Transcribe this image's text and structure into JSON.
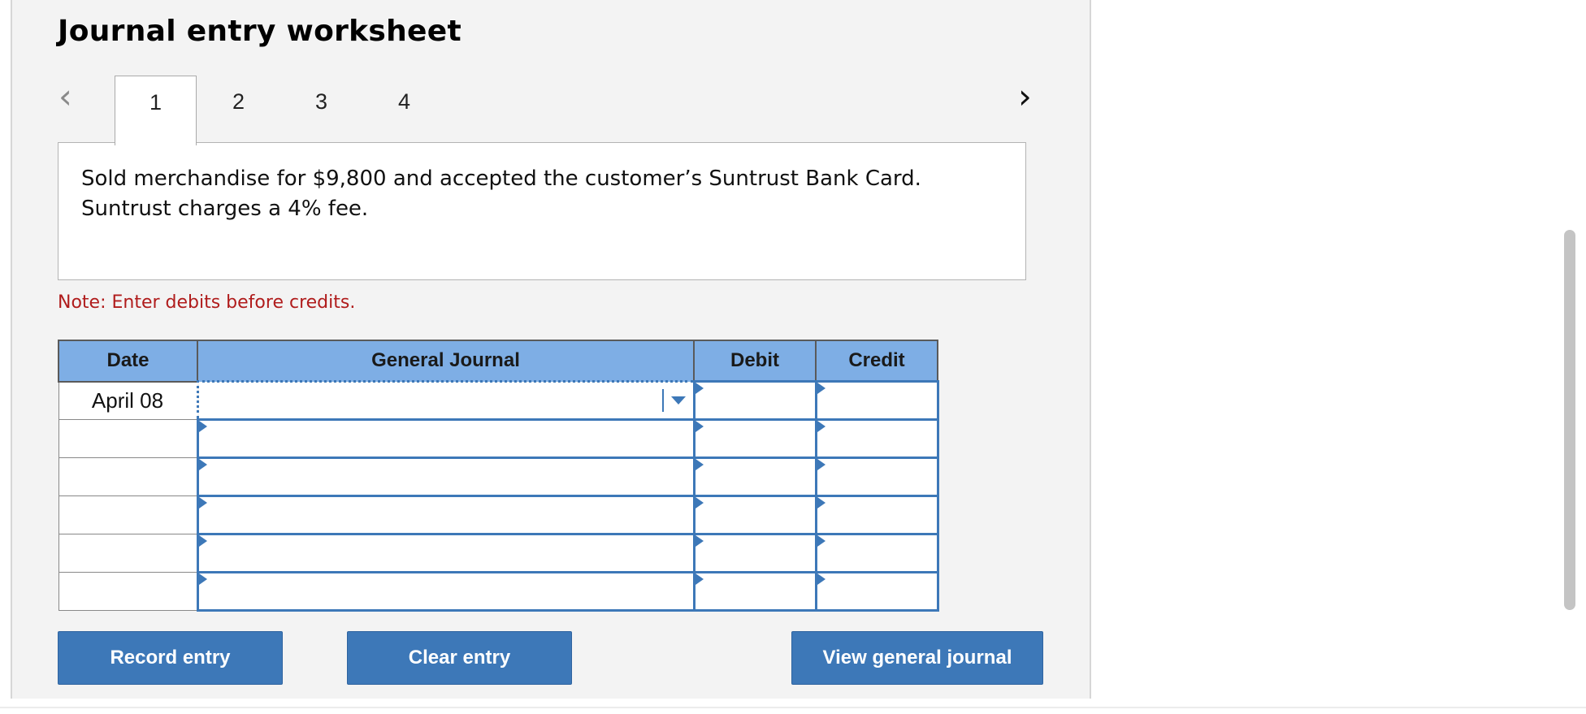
{
  "title": "Journal entry worksheet",
  "nav": {
    "prev_icon": "‹",
    "next_icon": "›"
  },
  "tabs": [
    {
      "label": "1",
      "active": true
    },
    {
      "label": "2",
      "active": false
    },
    {
      "label": "3",
      "active": false
    },
    {
      "label": "4",
      "active": false
    }
  ],
  "scenario": "Sold merchandise for $9,800 and accepted the customer’s Suntrust Bank Card. Suntrust charges a 4% fee.",
  "note": "Note: Enter debits before credits.",
  "table": {
    "headers": {
      "date": "Date",
      "general_journal": "General Journal",
      "debit": "Debit",
      "credit": "Credit"
    },
    "rows": [
      {
        "date": "April 08",
        "account": "",
        "debit": "",
        "credit": ""
      },
      {
        "date": "",
        "account": "",
        "debit": "",
        "credit": ""
      },
      {
        "date": "",
        "account": "",
        "debit": "",
        "credit": ""
      },
      {
        "date": "",
        "account": "",
        "debit": "",
        "credit": ""
      },
      {
        "date": "",
        "account": "",
        "debit": "",
        "credit": ""
      },
      {
        "date": "",
        "account": "",
        "debit": "",
        "credit": ""
      }
    ]
  },
  "buttons": {
    "record": "Record entry",
    "clear": "Clear entry",
    "view": "View general journal"
  },
  "colors": {
    "header_blue": "#7eaee5",
    "button_blue": "#3d78b8",
    "note_red": "#b01c1c"
  }
}
